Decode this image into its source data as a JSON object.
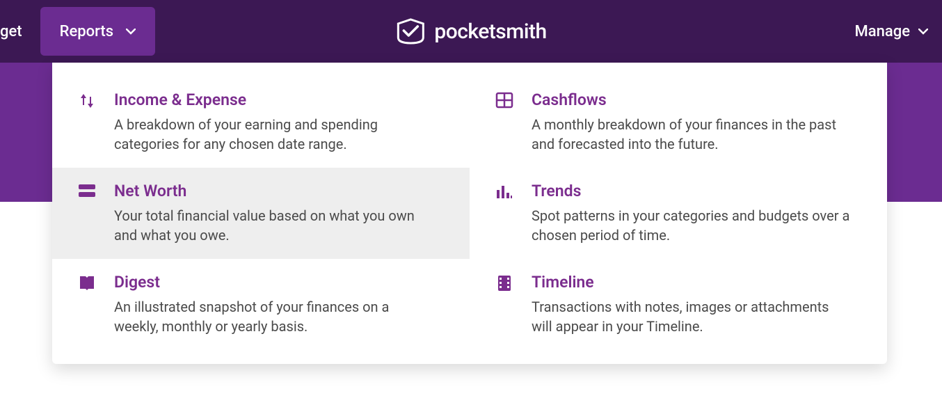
{
  "nav": {
    "partial_item": "get",
    "reports_label": "Reports",
    "manage_label": "Manage",
    "logo_text": "pocketsmith"
  },
  "menu": {
    "items": [
      {
        "title": "Income & Expense",
        "desc": "A breakdown of your earning and spending categories for any chosen date range."
      },
      {
        "title": "Cashflows",
        "desc": "A monthly breakdown of your finances in the past and forecasted into the future."
      },
      {
        "title": "Net Worth",
        "desc": "Your total financial value based on what you own and what you owe."
      },
      {
        "title": "Trends",
        "desc": "Spot patterns in your categories and budgets over a chosen period of time."
      },
      {
        "title": "Digest",
        "desc": "An illustrated snapshot of your finances on a weekly, monthly or yearly basis."
      },
      {
        "title": "Timeline",
        "desc": "Transactions with notes, images or attachments will appear in your Timeline."
      }
    ]
  }
}
